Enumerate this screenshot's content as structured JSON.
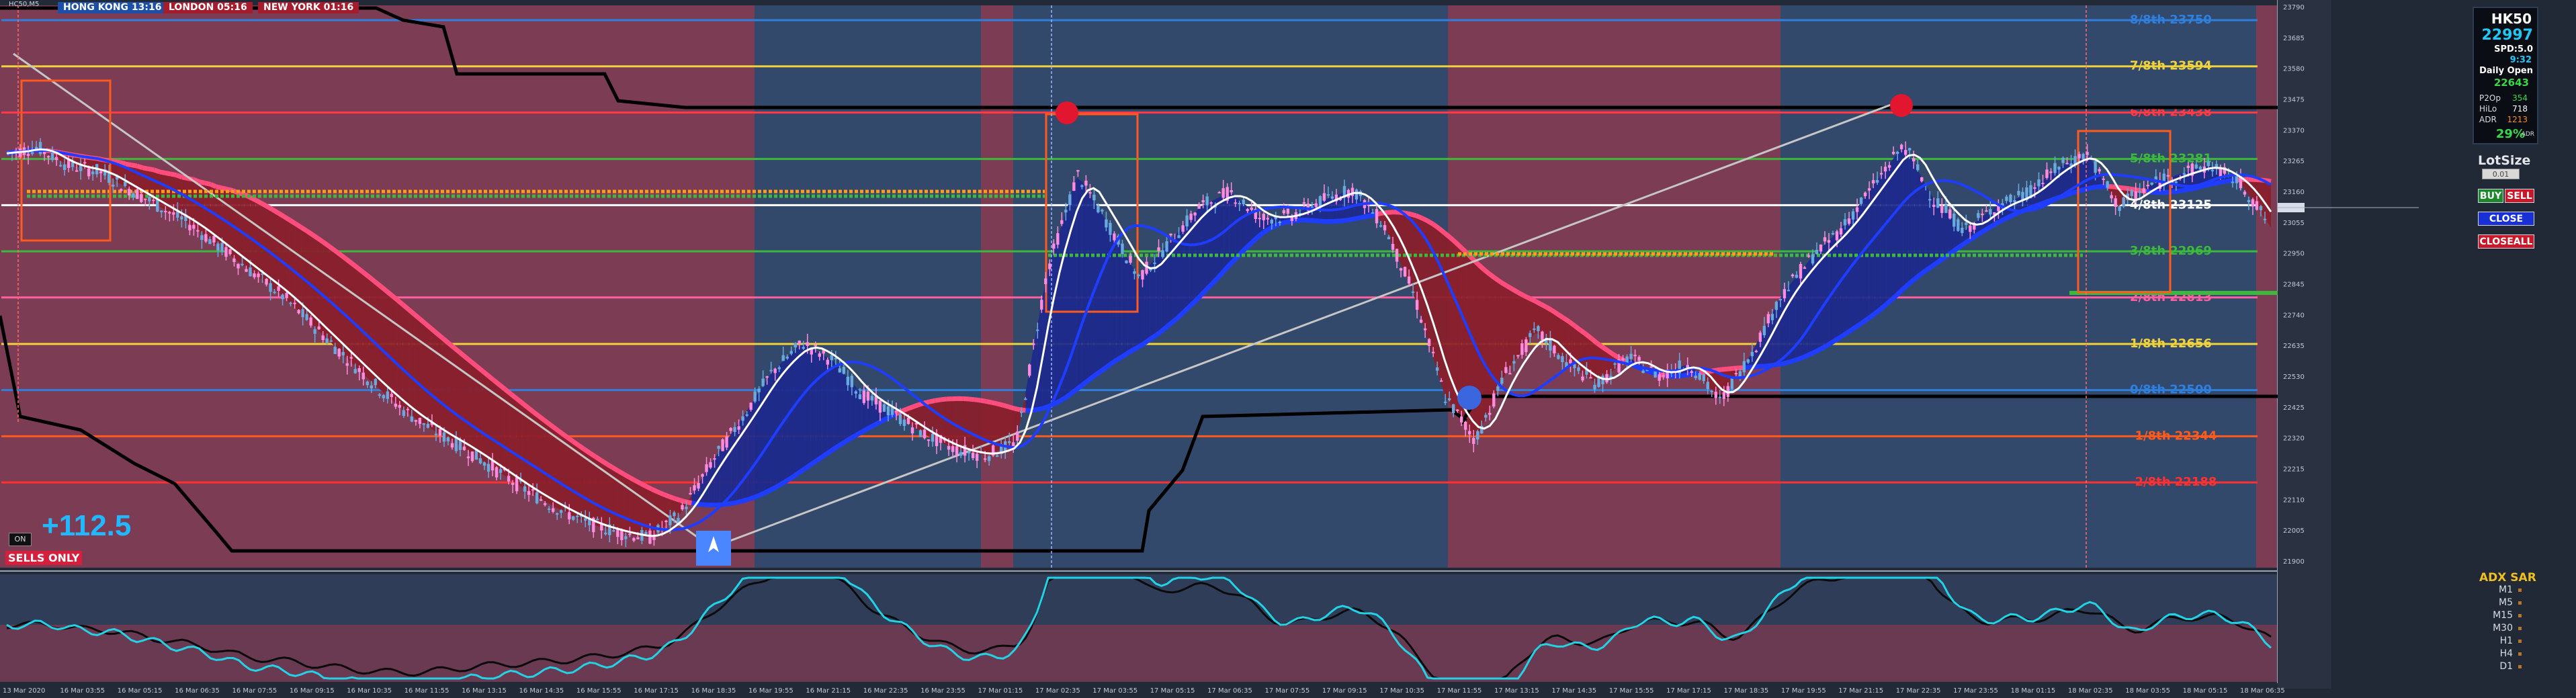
{
  "symbol": "HK50",
  "price": "22997",
  "spread": "SPD:5.0",
  "timer": "9:32",
  "daily_open_label": "Daily Open",
  "daily_open": "22643",
  "stats": [
    {
      "label": "P2Op",
      "value": "354",
      "color": "#38d84a"
    },
    {
      "label": "HiLo",
      "value": "718",
      "color": "#ffffff"
    },
    {
      "label": "ADR",
      "value": "1213",
      "color": "#ff8a1c"
    }
  ],
  "adr_pct": "29%",
  "adr_pct_suffix": "ADR",
  "sessions": [
    {
      "label": "HONG KONG 13:16",
      "color": "#1b4fa8"
    },
    {
      "label": "LONDON  05:16",
      "color": "#a51d2d"
    },
    {
      "label": "NEW YORK  01:16",
      "color": "#a51d2d"
    }
  ],
  "profit": "+112.5",
  "mode_badge": "SELLS ONLY",
  "on_badge": "ON",
  "top_left_tag": "HC50,M5",
  "lot_size_label": "LotSize",
  "lot_size_value": "0.01",
  "buttons": {
    "buy": "BUY",
    "sell": "SELL",
    "close": "CLOSE",
    "closeall": "CLOSEALL"
  },
  "murrey_levels": [
    {
      "label": "8/8th  23750",
      "value": 23750,
      "color": "#2f7fdc"
    },
    {
      "label": "7/8th  23594",
      "value": 23594,
      "color": "#f0d23c"
    },
    {
      "label": "6/8th  23438",
      "value": 23438,
      "color": "#ff3a46"
    },
    {
      "label": "5/8th  23281",
      "value": 23281,
      "color": "#3cb93c"
    },
    {
      "label": "4/8th  23125",
      "value": 23125,
      "color": "#ffffff"
    },
    {
      "label": "3/8th  22969",
      "value": 22969,
      "color": "#3cb93c"
    },
    {
      "label": "2/8th  22813",
      "value": 22813,
      "color": "#ff5fa0"
    },
    {
      "label": "1/8th  22656",
      "value": 22656,
      "color": "#f0d23c"
    },
    {
      "label": "0/8th  22500",
      "value": 22500,
      "color": "#2f7fdc"
    },
    {
      "label": "-1/8th  22344",
      "value": 22344,
      "color": "#ff5a1e"
    },
    {
      "label": "-2/8th  22188",
      "value": 22188,
      "color": "#ff3030"
    }
  ],
  "price_axis_ticks": [
    "23790",
    "23685",
    "23580",
    "23475",
    "23370",
    "23265",
    "23160",
    "23055",
    "22950",
    "22845",
    "22740",
    "22635",
    "22530",
    "22425",
    "22320",
    "22215",
    "22110",
    "22005",
    "21900"
  ],
  "indicator_title": "ADX SAR",
  "adx_timeframes": [
    "M1",
    "M5",
    "M15",
    "M30",
    "H1",
    "H4",
    "D1"
  ],
  "time_axis_labels": [
    "13 Mar 2020",
    "16 Mar 03:55",
    "16 Mar 05:15",
    "16 Mar 06:35",
    "16 Mar 07:55",
    "16 Mar 09:15",
    "16 Mar 10:35",
    "16 Mar 11:55",
    "16 Mar 13:15",
    "16 Mar 14:35",
    "16 Mar 15:55",
    "16 Mar 17:15",
    "16 Mar 18:35",
    "16 Mar 19:55",
    "16 Mar 21:15",
    "16 Mar 22:35",
    "16 Mar 23:55",
    "17 Mar 01:15",
    "17 Mar 02:35",
    "17 Mar 03:55",
    "17 Mar 05:15",
    "17 Mar 06:35",
    "17 Mar 07:55",
    "17 Mar 09:15",
    "17 Mar 10:35",
    "17 Mar 11:55",
    "17 Mar 13:15",
    "17 Mar 14:35",
    "17 Mar 15:55",
    "17 Mar 17:15",
    "17 Mar 18:35",
    "17 Mar 19:55",
    "17 Mar 21:15",
    "17 Mar 22:35",
    "17 Mar 23:55",
    "18 Mar 01:15",
    "18 Mar 02:35",
    "18 Mar 03:55",
    "18 Mar 05:15",
    "18 Mar 06:35"
  ],
  "chart_data": {
    "type": "candlestick",
    "symbol": "HK50",
    "timeframe": "M5",
    "ylim": [
      21900,
      23800
    ],
    "x_start": "13 Mar 2020",
    "x_end": "18 Mar 06:35",
    "close_path": [
      23300,
      23320,
      23260,
      23240,
      23180,
      23120,
      23060,
      22980,
      22900,
      22820,
      22720,
      22620,
      22520,
      22430,
      22360,
      22300,
      22230,
      22160,
      22100,
      22050,
      22020,
      22000,
      22080,
      22250,
      22400,
      22560,
      22660,
      22600,
      22480,
      22420,
      22350,
      22300,
      22280,
      22320,
      22900,
      23230,
      23060,
      22880,
      23000,
      23120,
      23170,
      23080,
      23090,
      23140,
      23180,
      23060,
      22820,
      22480,
      22330,
      22560,
      22700,
      22590,
      22520,
      22610,
      22550,
      22590,
      22460,
      22620,
      22820,
      22950,
      23050,
      23190,
      23330,
      23140,
      23040,
      23120,
      23160,
      23250,
      23300,
      23120,
      23190,
      23230,
      23260,
      23200,
      23050
    ],
    "colors": {
      "up": "#68a9e0",
      "down": "#ff8be0"
    }
  }
}
